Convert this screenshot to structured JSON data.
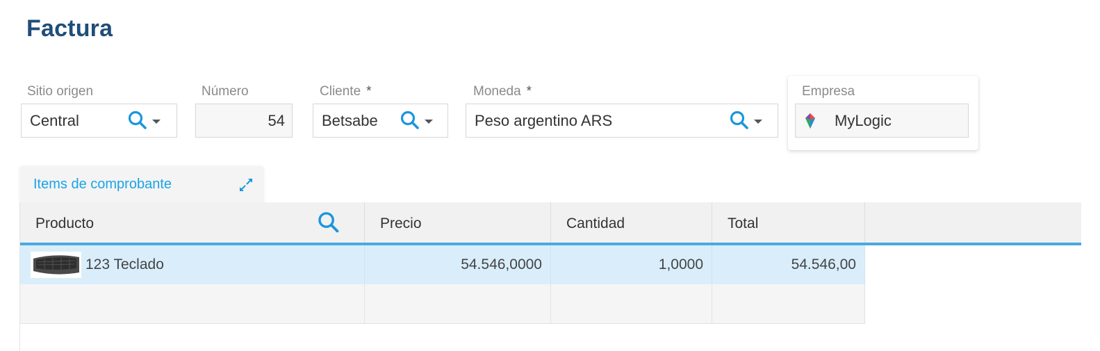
{
  "page_title": "Factura",
  "fields": {
    "sitio_origen": {
      "label": "Sitio origen",
      "value": "Central"
    },
    "numero": {
      "label": "Número",
      "value": "54"
    },
    "cliente": {
      "label": "Cliente",
      "required_mark": "*",
      "value": "Betsabe"
    },
    "moneda": {
      "label": "Moneda",
      "required_mark": "*",
      "value": "Peso argentino ARS"
    },
    "empresa": {
      "label": "Empresa",
      "value": "MyLogic"
    }
  },
  "tab": {
    "label": "Items de comprobante"
  },
  "grid": {
    "columns": [
      "Producto",
      "Precio",
      "Cantidad",
      "Total"
    ],
    "rows": [
      {
        "producto": "123 Teclado",
        "precio": "54.546,0000",
        "cantidad": "1,0000",
        "total": "54.546,00"
      }
    ]
  },
  "colors": {
    "title": "#1f4e79",
    "accent": "#1aa3e8",
    "selected_row": "#d9eefa",
    "header_border": "#4aa9de"
  },
  "icons": [
    "search-icon",
    "dropdown-caret-icon",
    "expand-icon",
    "company-logo-icon",
    "keyboard-product-image"
  ]
}
